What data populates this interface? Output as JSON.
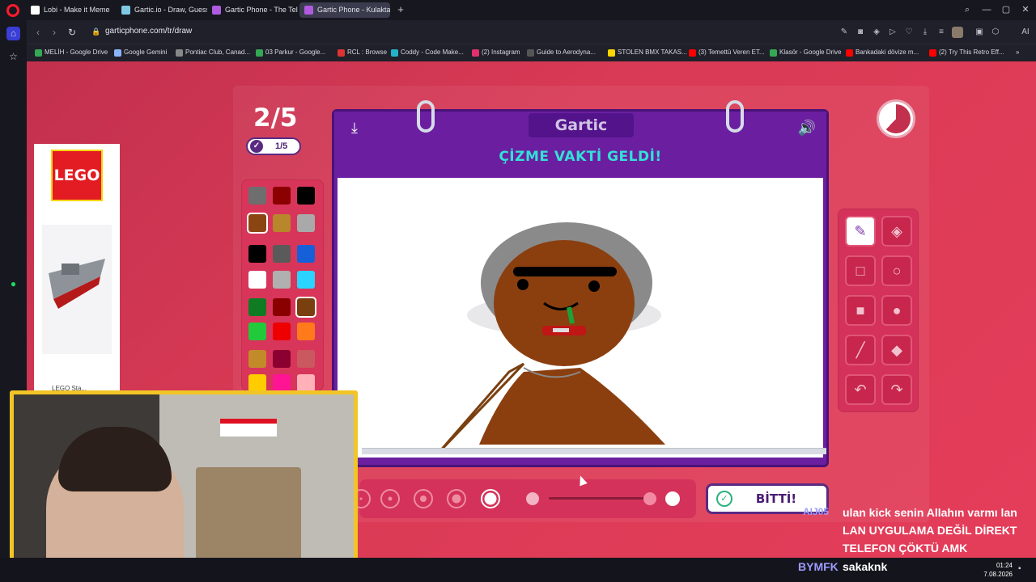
{
  "browser": {
    "tabs": [
      {
        "label": "Lobi - Make it Meme",
        "color": "#ffffff"
      },
      {
        "label": "Gartic.io - Draw, Guess, W",
        "color": "#7ec8e3"
      },
      {
        "label": "Gartic Phone - The Teleph",
        "color": "#b05ae0"
      },
      {
        "label": "Gartic Phone - Kulaktan K",
        "color": "#b05ae0"
      }
    ],
    "url": "garticphone.com/tr/draw",
    "bookmarks": [
      "MELİH - Google Drive",
      "Google Gemini",
      "Pontiac Club, Canad...",
      "03 Parkur - Google...",
      "RCL : Browse",
      "Coddy - Code Make...",
      "(2) Instagram",
      "Guide to Aerodyna...",
      "STOLEN BMX TAKAS...",
      "(3) Temettü Veren ET...",
      "Klasör - Google Drive",
      "Bankadaki dövize m...",
      "(2) Try This Retro Eff..."
    ]
  },
  "game": {
    "round": "2/5",
    "done_count": "1/5",
    "brand": "Gartic",
    "heading": "ÇİZME VAKTİ GELDİ!",
    "done_button": "BİTTİ!",
    "timer_elapsed_fraction": 0.62,
    "brush_opacity_fraction": 0.98,
    "palette": [
      "#6e6e6e",
      "#8b0000",
      "#000000",
      "#8b4513",
      "#b8862b",
      "#a9a9a9",
      "#000000",
      "#5a5a5a",
      "#1560d8",
      "#ffffff",
      "#b0b0b0",
      "#2ad4ff",
      "#0f7b22",
      "#8a0000",
      "#7a3f0f",
      "#22c93a",
      "#ee0000",
      "#ff7a1a",
      "#c38a2a",
      "#8b0030",
      "#c9585f",
      "#ffcc00",
      "#ff1493",
      "#ffb0b8"
    ],
    "selected_color": "#7a3f0f"
  },
  "ad": {
    "logo": "LEGO",
    "caption": "LEGO Sta..."
  },
  "chat": [
    {
      "user": "AIJ05",
      "text": "ulan kick senin Allahın varmı lan"
    },
    {
      "user": "",
      "text": "LAN UYGULAMA DEĞİL DİREKT"
    },
    {
      "user": "",
      "text": "TELEFON ÇÖKTÜ AMK"
    },
    {
      "user": "BYMFK",
      "text": "sakaknk"
    }
  ],
  "clock": {
    "time": "01:24",
    "date": "7.08.2026"
  }
}
